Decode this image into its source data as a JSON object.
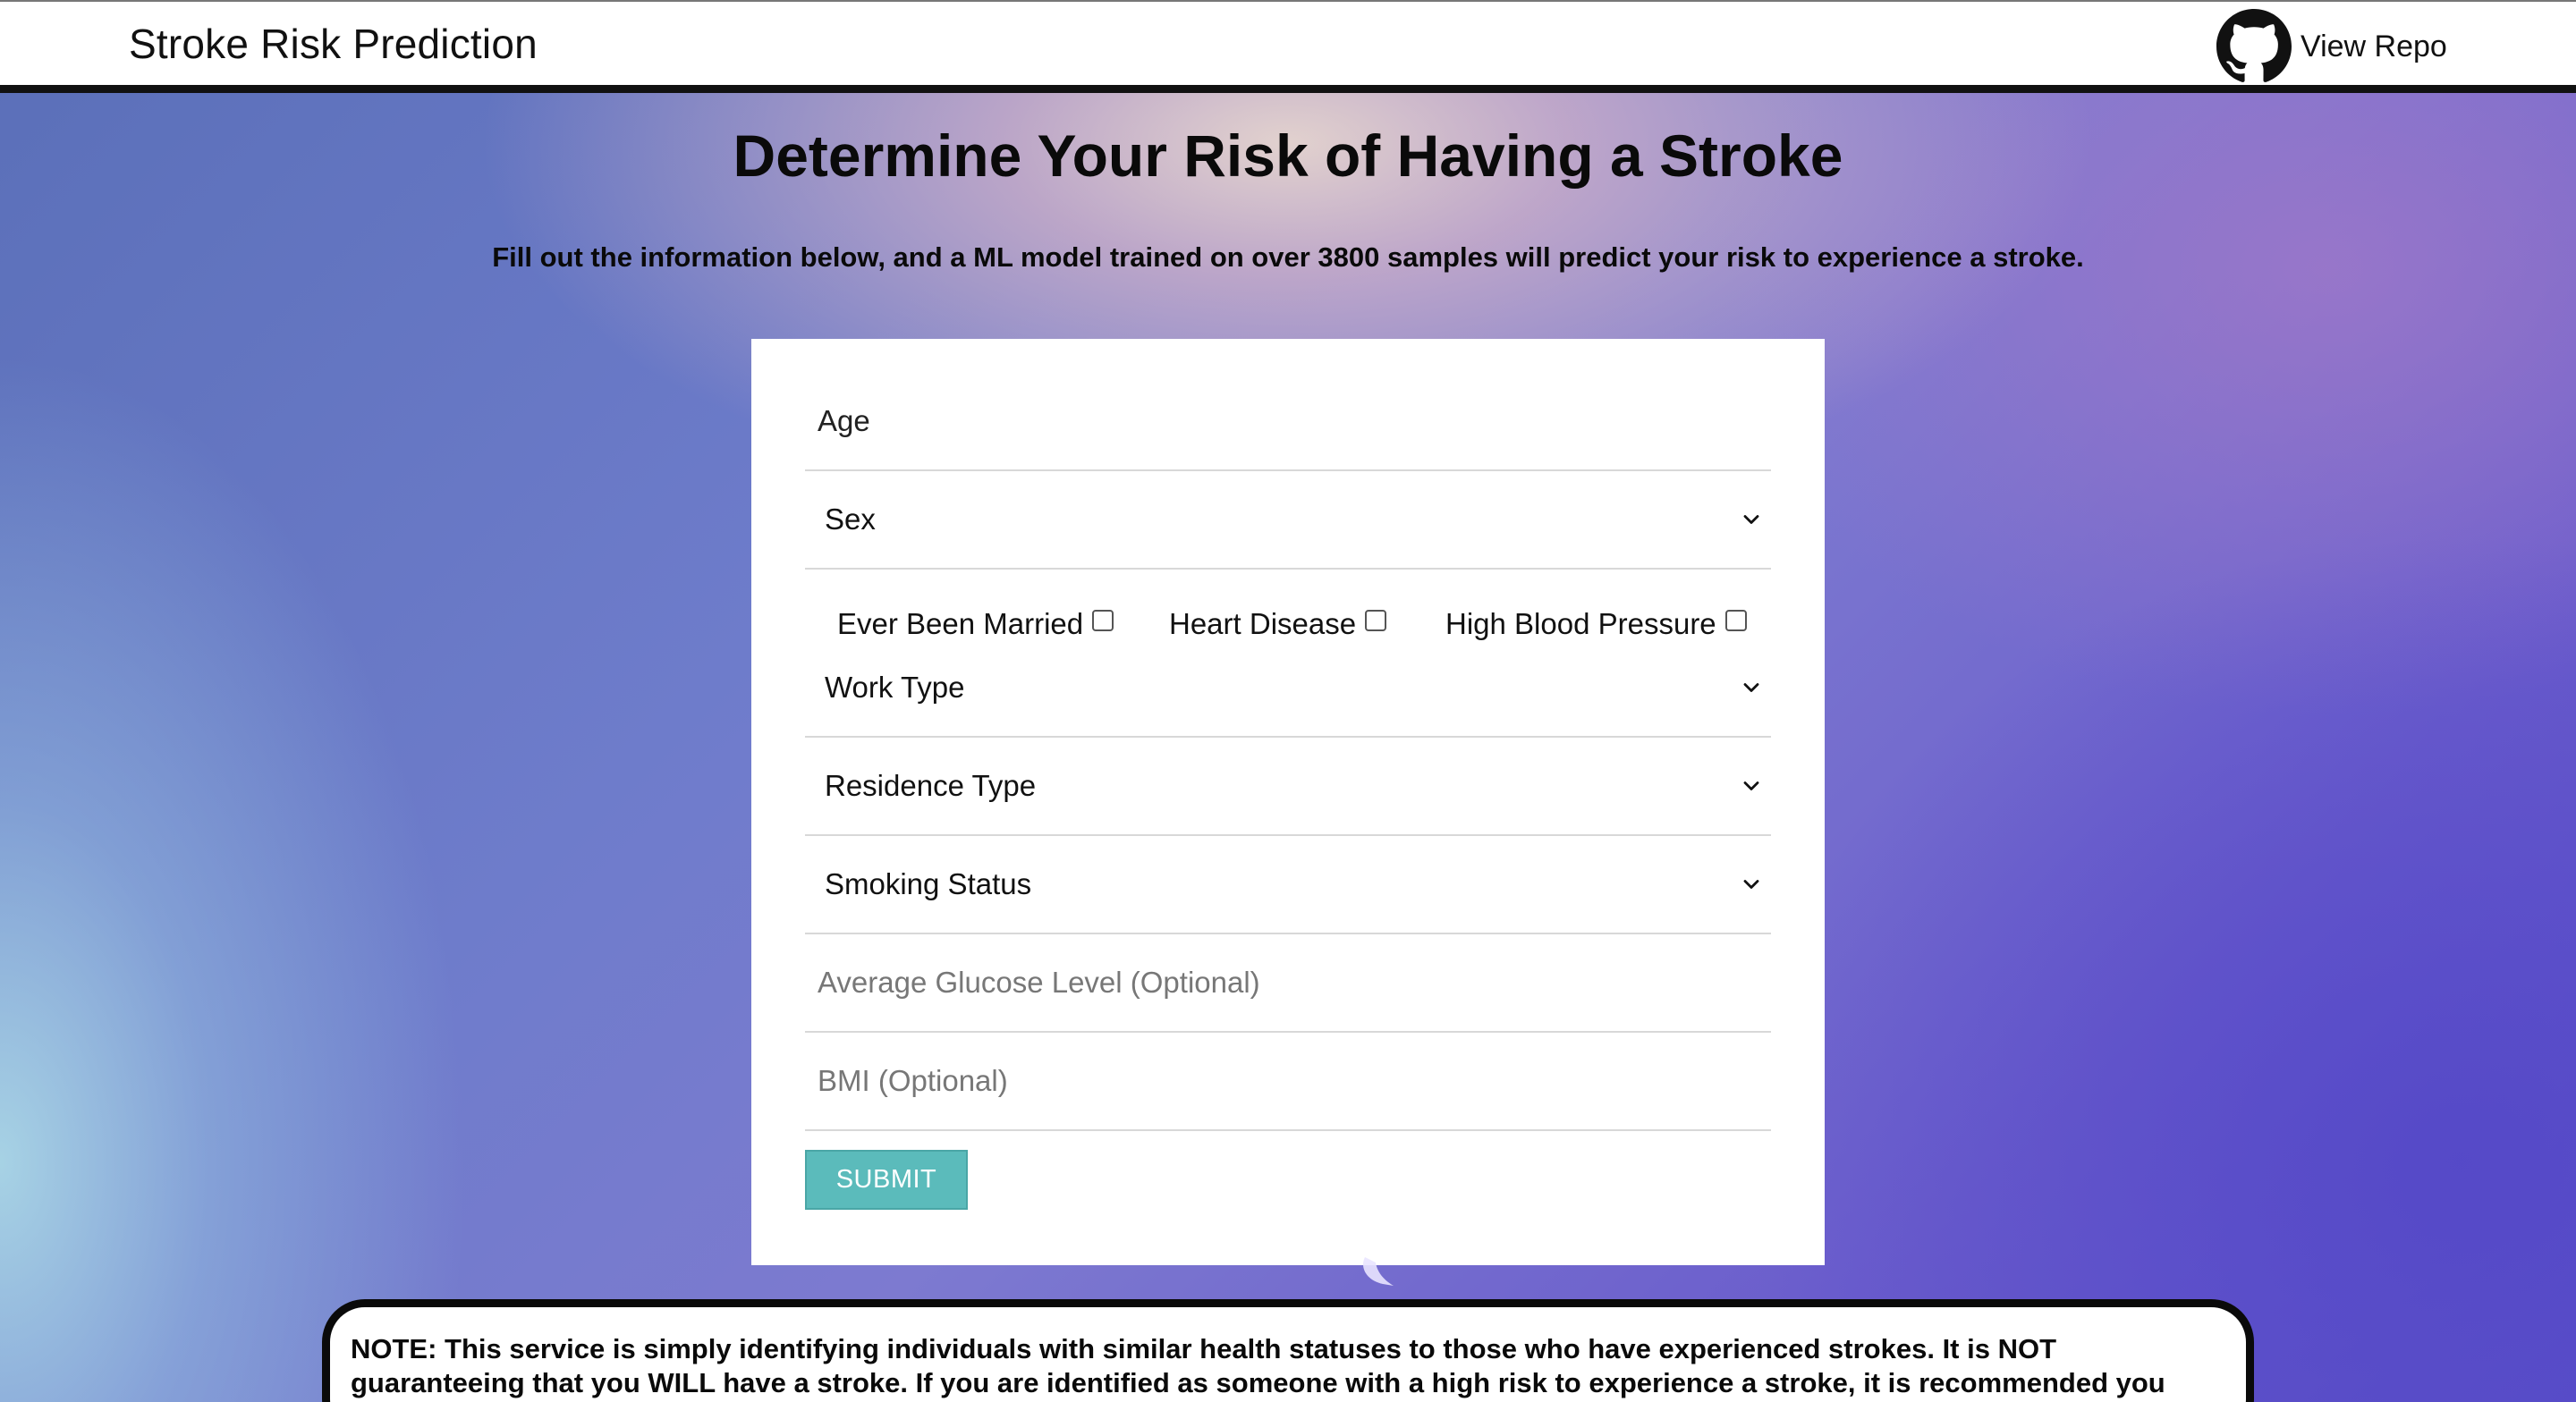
{
  "header": {
    "title": "Stroke Risk Prediction",
    "repo_link_label": "View Repo",
    "repo_icon": "github-icon"
  },
  "main": {
    "heading": "Determine Your Risk of Having a Stroke",
    "subheading": "Fill out the information below, and a ML model trained on over 3800 samples will predict your risk to experience a stroke."
  },
  "form": {
    "age": {
      "placeholder": "Age",
      "value": ""
    },
    "sex": {
      "label": "Sex",
      "icon": "chevron-down-icon"
    },
    "checkboxes": [
      {
        "label": "Ever Been Married",
        "checked": false
      },
      {
        "label": "Heart Disease",
        "checked": false
      },
      {
        "label": "High Blood Pressure",
        "checked": false
      }
    ],
    "work_type": {
      "label": "Work Type",
      "icon": "chevron-down-icon"
    },
    "residence_type": {
      "label": "Residence Type",
      "icon": "chevron-down-icon"
    },
    "smoking_status": {
      "label": "Smoking Status",
      "icon": "chevron-down-icon"
    },
    "glucose": {
      "placeholder": "Average Glucose Level (Optional)",
      "value": ""
    },
    "bmi": {
      "placeholder": "BMI (Optional)",
      "value": ""
    },
    "submit_label": "SUBMIT",
    "submit_color": "#5bbbbb"
  },
  "note": {
    "text": "NOTE: This service is simply identifying individuals with similar health statuses to those who have experienced strokes. It is NOT guaranteeing that you WILL have a stroke. If you are identified as someone with a high risk to experience a stroke, it is recommended you reach out to a medical professional for further evaluation and/or consultation."
  }
}
